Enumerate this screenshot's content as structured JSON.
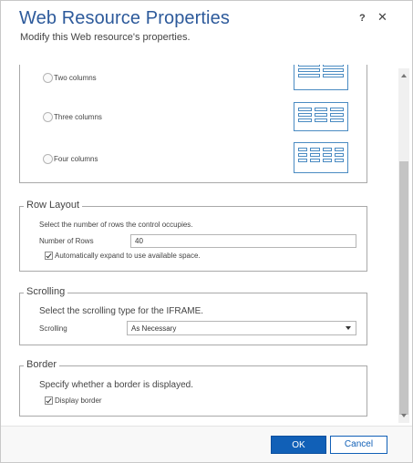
{
  "header": {
    "title": "Web Resource Properties",
    "subtitle": "Modify this Web resource's properties.",
    "help_label": "?",
    "close_label": "✕"
  },
  "column_layout": {
    "options": [
      {
        "label": "Two columns"
      },
      {
        "label": "Three columns"
      },
      {
        "label": "Four columns"
      }
    ]
  },
  "row_layout": {
    "legend": "Row Layout",
    "description": "Select the number of rows the control occupies.",
    "rows_label": "Number of Rows",
    "rows_value": "40",
    "auto_expand_label": "Automatically expand to use available space.",
    "auto_expand_checked": true
  },
  "scrolling": {
    "legend": "Scrolling",
    "description": "Select the scrolling type for the IFRAME.",
    "scrolling_label": "Scrolling",
    "scrolling_value": "As Necessary"
  },
  "border": {
    "legend": "Border",
    "description": "Specify whether a border is displayed.",
    "display_border_label": "Display border",
    "display_border_checked": true
  },
  "footer": {
    "ok_label": "OK",
    "cancel_label": "Cancel"
  },
  "colors": {
    "title": "#2d5a9b",
    "primary_button": "#1160b7",
    "icon_stroke": "#4a8bc2"
  }
}
